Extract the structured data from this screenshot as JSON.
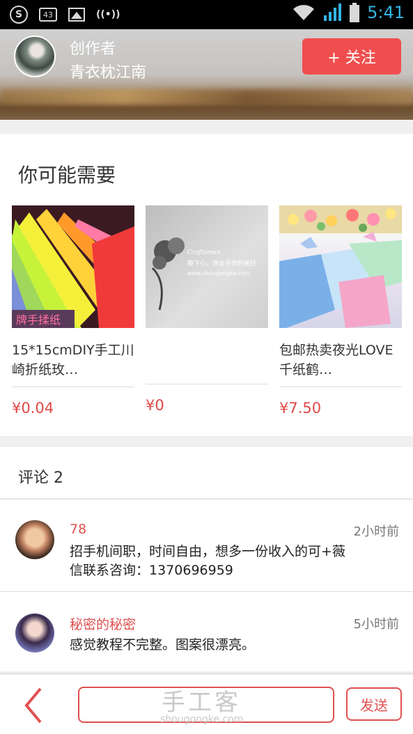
{
  "status_bar": {
    "time": "5:41",
    "badge_count": "43",
    "colors": {
      "time": "#33b5e5",
      "icons": "#d8d8d8"
    }
  },
  "header": {
    "creator_label": "创作者",
    "creator_name": "青衣枕江南",
    "follow_label": "+ 关注",
    "accent_color": "#f04e4e"
  },
  "recommend": {
    "title": "你可能需要",
    "items": [
      {
        "name": "15*15cmDIY手工川崎折纸玫…",
        "price": "¥0.04"
      },
      {
        "name": "",
        "price": "¥0",
        "thumb_text_1": "Craftsmen",
        "thumb_text_2": "静下心，体会手作的美好",
        "thumb_text_3": "www.shougongke.com"
      },
      {
        "name": "包邮热卖夜光LOVE千纸鹤…",
        "price": "¥7.50"
      }
    ]
  },
  "comments": {
    "title": "评论 2",
    "items": [
      {
        "user": "78",
        "time": "2小时前",
        "text": "招手机间职，时间自由，想多一份收入的可+薇信联系咨询：1370696959"
      },
      {
        "user": "秘密的秘密",
        "time": "5小时前",
        "text": "感觉教程不完整。图案很漂亮。"
      }
    ]
  },
  "bottom_bar": {
    "input_value": "",
    "send_label": "发送",
    "watermark": "手工客",
    "watermark_url": "shougongke.com"
  }
}
